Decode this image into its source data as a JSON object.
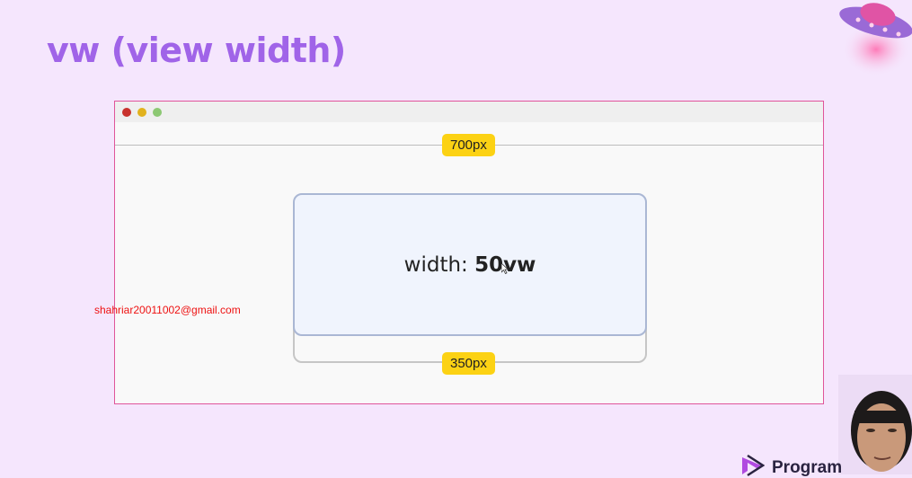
{
  "slide": {
    "title": "vw (view width)",
    "brand": "Program"
  },
  "diagram": {
    "viewport_width_label": "700px",
    "box_label_prefix": "width: ",
    "box_label_value": "50vw",
    "box_width_label": "350px"
  },
  "watermark": {
    "email": "shahriar20011002@gmail.com"
  },
  "colors": {
    "title": "#a064e8",
    "badge": "#fcd214",
    "browser_border": "#e0559a",
    "background": "#f5e6fd"
  }
}
